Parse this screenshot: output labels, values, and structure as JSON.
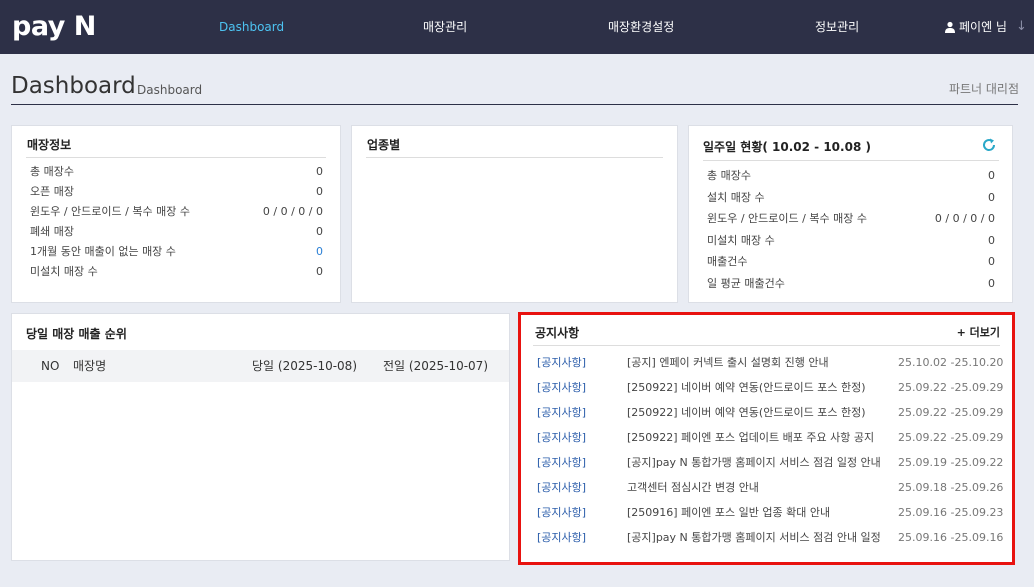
{
  "header": {
    "logo": "pay N",
    "nav": [
      "Dashboard",
      "매장관리",
      "매장환경설정",
      "정보관리"
    ],
    "user": "페이엔 님"
  },
  "page": {
    "title": "Dashboard",
    "crumb": "Dashboard",
    "partner": "파트너 대리점"
  },
  "store_info": {
    "title": "매장정보",
    "rows": [
      {
        "label": "총 매장수",
        "value": "0"
      },
      {
        "label": "오픈 매장",
        "value": "0"
      },
      {
        "label": "윈도우 / 안드로이드 / 복수 매장 수",
        "value": "0 / 0 / 0 / 0"
      },
      {
        "label": "폐쇄 매장",
        "value": "0"
      },
      {
        "label": "1개월 동안 매출이 없는 매장 수",
        "value": "0"
      },
      {
        "label": "미설치 매장 수",
        "value": "0"
      }
    ]
  },
  "industry": {
    "title": "업종별"
  },
  "weekly": {
    "title": "일주일 현황( 10.02 - 10.08 )",
    "rows": [
      {
        "label": "총 매장수",
        "value": "0"
      },
      {
        "label": "설치 매장 수",
        "value": "0"
      },
      {
        "label": "윈도우 / 안드로이드 / 복수 매장 수",
        "value": "0 / 0 / 0 / 0"
      },
      {
        "label": "미설치 매장 수",
        "value": "0"
      },
      {
        "label": "매출건수",
        "value": "0"
      },
      {
        "label": "일 평균 매출건수",
        "value": "0"
      }
    ]
  },
  "ranking": {
    "title": "당일 매장 매출 순위",
    "columns": [
      "NO",
      "매장명",
      "당일 (2025-10-08)",
      "전일 (2025-10-07)"
    ]
  },
  "notice": {
    "title": "공지사항",
    "more": "+ 더보기",
    "items": [
      {
        "cat": "[공지사항]",
        "title": "[공지] 엔페이 커넥트 출시 설명회 진행 안내",
        "date": "25.10.02 -25.10.20"
      },
      {
        "cat": "[공지사항]",
        "title": "[250922] 네이버 예약 연동(안드로이드 포스 한정)",
        "date": "25.09.22 -25.09.29"
      },
      {
        "cat": "[공지사항]",
        "title": "[250922] 네이버 예약 연동(안드로이드 포스 한정)",
        "date": "25.09.22 -25.09.29"
      },
      {
        "cat": "[공지사항]",
        "title": "[250922] 페이엔 포스 업데이트 배포 주요 사항 공지",
        "date": "25.09.22 -25.09.29"
      },
      {
        "cat": "[공지사항]",
        "title": "[공지]pay N 통합가맹 홈페이지 서비스 점검 일정 안내",
        "date": "25.09.19 -25.09.22"
      },
      {
        "cat": "[공지사항]",
        "title": "고객센터 점심시간 변경 안내",
        "date": "25.09.18 -25.09.26"
      },
      {
        "cat": "[공지사항]",
        "title": "[250916] 페이엔 포스 일반 업종 확대 안내",
        "date": "25.09.16 -25.09.23"
      },
      {
        "cat": "[공지사항]",
        "title": "[공지]pay N 통합가맹 홈페이지 서비스 점검 안내 일정",
        "date": "25.09.16 -25.09.16"
      }
    ]
  },
  "colors": {
    "header_bg": "#2d3047",
    "active_nav": "#4dc3f2",
    "highlight_border": "#e8120f",
    "notice_category": "#2a5caa"
  }
}
